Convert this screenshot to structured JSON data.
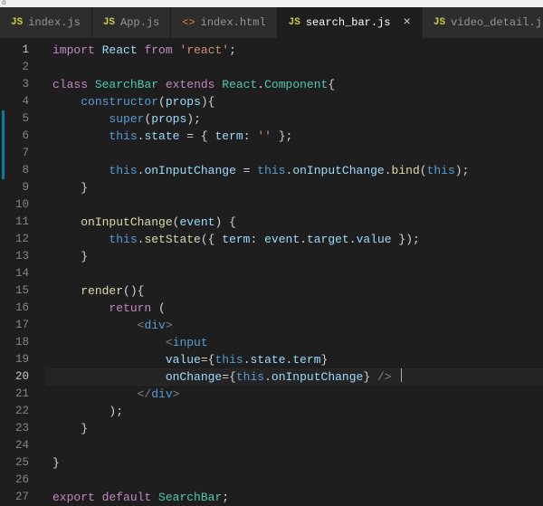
{
  "window_frame_text": "o",
  "tabs": [
    {
      "label": "index.js",
      "icon": "JS",
      "icon_type": "js",
      "active": false,
      "close": false
    },
    {
      "label": "App.js",
      "icon": "JS",
      "icon_type": "js",
      "active": false,
      "close": false
    },
    {
      "label": "index.html",
      "icon": "<>",
      "icon_type": "html",
      "active": false,
      "close": false
    },
    {
      "label": "search_bar.js",
      "icon": "JS",
      "icon_type": "js",
      "active": true,
      "close": true
    },
    {
      "label": "video_detail.js",
      "icon": "JS",
      "icon_type": "js",
      "active": false,
      "close": false
    }
  ],
  "line_count": 27,
  "active_lines": [
    1,
    20
  ],
  "modified_ranges": [
    [
      5,
      8
    ]
  ],
  "code_lines": [
    [
      [
        "kw",
        "import"
      ],
      [
        "pun",
        " "
      ],
      [
        "prop",
        "React"
      ],
      [
        "pun",
        " "
      ],
      [
        "kw",
        "from"
      ],
      [
        "pun",
        " "
      ],
      [
        "str",
        "'react'"
      ],
      [
        "pun",
        ";"
      ]
    ],
    [],
    [
      [
        "kw",
        "class"
      ],
      [
        "pun",
        " "
      ],
      [
        "type",
        "SearchBar"
      ],
      [
        "pun",
        " "
      ],
      [
        "kw",
        "extends"
      ],
      [
        "pun",
        " "
      ],
      [
        "type",
        "React"
      ],
      [
        "pun",
        "."
      ],
      [
        "type",
        "Component"
      ],
      [
        "pun",
        "{"
      ]
    ],
    [
      [
        "pun",
        "    "
      ],
      [
        "kw2",
        "constructor"
      ],
      [
        "pun",
        "("
      ],
      [
        "prop",
        "props"
      ],
      [
        "pun",
        "){"
      ]
    ],
    [
      [
        "pun",
        "        "
      ],
      [
        "kw2",
        "super"
      ],
      [
        "pun",
        "("
      ],
      [
        "prop",
        "props"
      ],
      [
        "pun",
        ");"
      ]
    ],
    [
      [
        "pun",
        "        "
      ],
      [
        "kw2",
        "this"
      ],
      [
        "pun",
        "."
      ],
      [
        "prop",
        "state"
      ],
      [
        "pun",
        " = { "
      ],
      [
        "prop",
        "term"
      ],
      [
        "pun",
        ":"
      ],
      [
        "pun",
        " "
      ],
      [
        "str",
        "''"
      ],
      [
        "pun",
        " };"
      ]
    ],
    [],
    [
      [
        "pun",
        "        "
      ],
      [
        "kw2",
        "this"
      ],
      [
        "pun",
        "."
      ],
      [
        "prop",
        "onInputChange"
      ],
      [
        "pun",
        " = "
      ],
      [
        "kw2",
        "this"
      ],
      [
        "pun",
        "."
      ],
      [
        "prop",
        "onInputChange"
      ],
      [
        "pun",
        "."
      ],
      [
        "fn",
        "bind"
      ],
      [
        "pun",
        "("
      ],
      [
        "kw2",
        "this"
      ],
      [
        "pun",
        ");"
      ]
    ],
    [
      [
        "pun",
        "    }"
      ]
    ],
    [],
    [
      [
        "pun",
        "    "
      ],
      [
        "fn",
        "onInputChange"
      ],
      [
        "pun",
        "("
      ],
      [
        "prop",
        "event"
      ],
      [
        "pun",
        ") {"
      ]
    ],
    [
      [
        "pun",
        "        "
      ],
      [
        "kw2",
        "this"
      ],
      [
        "pun",
        "."
      ],
      [
        "fn",
        "setState"
      ],
      [
        "pun",
        "({ "
      ],
      [
        "prop",
        "term"
      ],
      [
        "pun",
        ":"
      ],
      [
        "pun",
        " "
      ],
      [
        "prop",
        "event"
      ],
      [
        "pun",
        "."
      ],
      [
        "prop",
        "target"
      ],
      [
        "pun",
        "."
      ],
      [
        "prop",
        "value"
      ],
      [
        "pun",
        " });"
      ]
    ],
    [
      [
        "pun",
        "    }"
      ]
    ],
    [],
    [
      [
        "pun",
        "    "
      ],
      [
        "fn",
        "render"
      ],
      [
        "pun",
        "(){"
      ]
    ],
    [
      [
        "pun",
        "        "
      ],
      [
        "kw",
        "return"
      ],
      [
        "pun",
        " ("
      ]
    ],
    [
      [
        "pun",
        "            "
      ],
      [
        "angle",
        "<"
      ],
      [
        "tag",
        "div"
      ],
      [
        "angle",
        ">"
      ]
    ],
    [
      [
        "pun",
        "                "
      ],
      [
        "angle",
        "<"
      ],
      [
        "tag",
        "input"
      ]
    ],
    [
      [
        "pun",
        "                "
      ],
      [
        "prop",
        "value"
      ],
      [
        "pun",
        "="
      ],
      [
        "pun",
        "{"
      ],
      [
        "kw2",
        "this"
      ],
      [
        "pun",
        "."
      ],
      [
        "prop",
        "state"
      ],
      [
        "pun",
        "."
      ],
      [
        "prop",
        "term"
      ],
      [
        "pun",
        "}"
      ]
    ],
    [
      [
        "pun",
        "                "
      ],
      [
        "prop",
        "onChange"
      ],
      [
        "pun",
        "="
      ],
      [
        "pun",
        "{"
      ],
      [
        "kw2",
        "this"
      ],
      [
        "pun",
        "."
      ],
      [
        "prop",
        "onInputChange"
      ],
      [
        "pun",
        "}"
      ],
      [
        "pun",
        " "
      ],
      [
        "angle",
        "/>"
      ]
    ],
    [
      [
        "pun",
        "            "
      ],
      [
        "angle",
        "</"
      ],
      [
        "tag",
        "div"
      ],
      [
        "angle",
        ">"
      ]
    ],
    [
      [
        "pun",
        "        );"
      ]
    ],
    [
      [
        "pun",
        "    }"
      ]
    ],
    [],
    [
      [
        "pun",
        "}"
      ]
    ],
    [],
    [
      [
        "kw",
        "export"
      ],
      [
        "pun",
        " "
      ],
      [
        "kw",
        "default"
      ],
      [
        "pun",
        " "
      ],
      [
        "type",
        "SearchBar"
      ],
      [
        "pun",
        ";"
      ]
    ]
  ]
}
